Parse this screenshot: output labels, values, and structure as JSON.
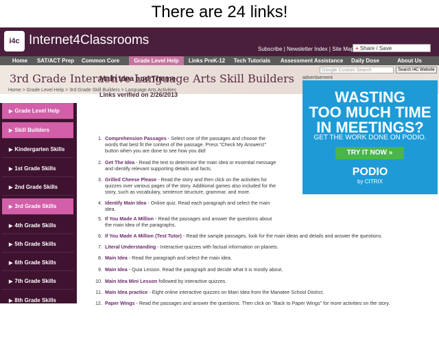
{
  "caption": "There are 24 links!",
  "site": {
    "logo": "i4c",
    "name": "Internet4Classrooms",
    "top_links": "Subscribe | Newsletter Index | Site Map",
    "share_label": "Share / Save"
  },
  "nav": [
    "Home",
    "SAT/ACT Prep",
    "Common Core",
    "Grade Level Help",
    "Links PreK-12",
    "Tech Tutorials",
    "Assessment Assistance",
    "Daily Dose",
    "About Us"
  ],
  "search": {
    "placeholder": "Google Custom Search",
    "button": "Search I4C Website"
  },
  "page_title": "3rd Grade Interactive Language Arts Skill Builders",
  "breadcrumb": "Home > Grade Level Help > 3rd Grade Skill Builders > Language Arts Activities",
  "sidebar": [
    {
      "label": "Grade Level Help",
      "highlight": true
    },
    {
      "label": "Skill Builders",
      "highlight": true
    },
    {
      "label": "Kindergarten Skills",
      "highlight": false
    },
    {
      "label": "1st Grade Skills",
      "highlight": false
    },
    {
      "label": "2nd Grade Skills",
      "highlight": false
    },
    {
      "label": "3rd Grade Skills",
      "highlight": true
    },
    {
      "label": "4th Grade Skills",
      "highlight": false
    },
    {
      "label": "5th Grade Skills",
      "highlight": false
    },
    {
      "label": "6th Grade Skills",
      "highlight": false
    },
    {
      "label": "7th Grade Skills",
      "highlight": false
    },
    {
      "label": "8th Grade Skills",
      "highlight": false
    }
  ],
  "main": {
    "heading": "Main Idea and Theme",
    "verified": "Links verified on 2/26/2013"
  },
  "ad": {
    "label": "advertisement",
    "line1": "WASTING",
    "line2": "TOO MUCH TIME",
    "line3": "IN MEETINGS?",
    "line4": "GET THE WORK DONE ON PODIO.",
    "button": "TRY IT NOW »",
    "brand": "PODIO",
    "by": "by CITRIX"
  },
  "links": [
    {
      "num": "1.",
      "title": "Comprehension Passages",
      "text": " - Select one of the passages and choose the",
      "more": [
        "words that best fit the context of the passage. Press \"Check My Answers!\"",
        "button when you are done to see how you did!"
      ]
    },
    {
      "num": "2.",
      "title": "Get The Idea",
      "text": " - Read the text to determine the main idea or essential message",
      "more": [
        "and identify relevant supporting details and facts."
      ]
    },
    {
      "num": "3.",
      "title": "Grilled Cheese Please",
      "text": " - Read the story and then click on the activities for",
      "more": [
        "quizzes over various pages of the story. Additional games also included for the",
        "story, such as vocabulary, sentence structure, grammar, and more."
      ]
    },
    {
      "num": "4.",
      "title": "Identify Main Idea",
      "text": " - Online quiz. Read each paragraph and select the main",
      "more": [
        "idea."
      ]
    },
    {
      "num": "5.",
      "title": "If You Made A Million",
      "text": " - Read the passages and answer the questions about",
      "more": [
        "the main idea of the paragraphs."
      ]
    },
    {
      "num": "6.",
      "title": "If You Made A Million (Test Tutor)",
      "text": " - Read the sample passages, look for the main ideas and details and answer the questions.",
      "more": []
    },
    {
      "num": "7.",
      "title": "Literal Understanding",
      "text": " - Interactive quizzes with factual information on planets.",
      "more": []
    },
    {
      "num": "8.",
      "title": "Main Idea",
      "text": " - Read the paragraph and select the main idea.",
      "more": []
    },
    {
      "num": "9.",
      "title": "Main Idea",
      "text": " - Quia Lesson. Read the paragraph and decide what it is mostly about.",
      "more": []
    },
    {
      "num": "10.",
      "title": "Main Idea Mini Lesson",
      "text": " followed by interactive quizzes.",
      "more": []
    },
    {
      "num": "11.",
      "title": "Main Idea practice",
      "text": " - Eight online interactive quizzes on Main Idea from the Manatee School District.",
      "more": []
    },
    {
      "num": "12.",
      "title": "Paper Wings",
      "text": " - Read the passages and answer the questions. Then click on \"Back to Paper Wings\" for more activities on the story.",
      "more": []
    }
  ]
}
